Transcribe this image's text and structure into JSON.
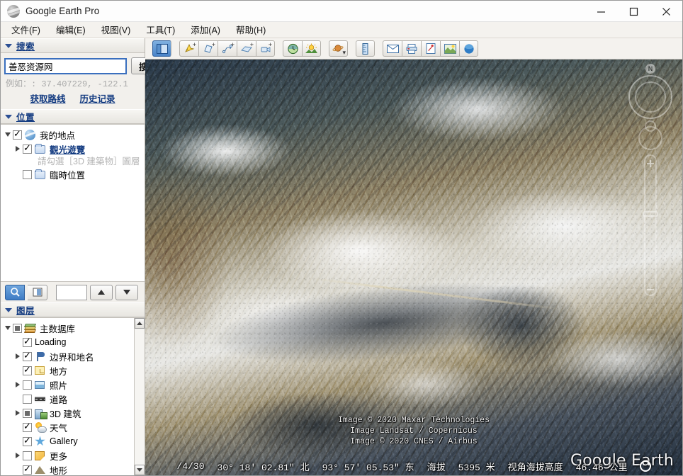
{
  "window": {
    "title": "Google Earth Pro",
    "app_icon": "globe-icon",
    "minimize": "–",
    "maximize": "□",
    "close": "✕"
  },
  "menubar": {
    "items": [
      {
        "label": "文件(F)",
        "name": "menu-file"
      },
      {
        "label": "编辑(E)",
        "name": "menu-edit"
      },
      {
        "label": "视图(V)",
        "name": "menu-view"
      },
      {
        "label": "工具(T)",
        "name": "menu-tools"
      },
      {
        "label": "添加(A)",
        "name": "menu-add"
      },
      {
        "label": "帮助(H)",
        "name": "menu-help"
      }
    ]
  },
  "toolbar": {
    "groups": [
      {
        "tools": [
          {
            "name": "toggle-sidebar-icon",
            "title": "显示/隐藏侧边栏",
            "selected": true
          }
        ]
      },
      {
        "tools": [
          {
            "name": "add-placemark-icon",
            "title": "添加地标",
            "badge": "+"
          },
          {
            "name": "add-polygon-icon",
            "title": "添加多边形",
            "badge": "+"
          },
          {
            "name": "add-path-icon",
            "title": "添加路径",
            "badge": "+"
          },
          {
            "name": "add-image-overlay-icon",
            "title": "添加图像叠加层",
            "badge": "+"
          },
          {
            "name": "record-tour-icon",
            "title": "录制游览",
            "badge": "+"
          }
        ]
      },
      {
        "tools": [
          {
            "name": "historical-imagery-icon",
            "title": "显示历史图像"
          },
          {
            "name": "sunlight-icon",
            "title": "显示横跨景观的阳光"
          }
        ]
      },
      {
        "tools": [
          {
            "name": "planet-switch-icon",
            "title": "在天空、火星和月球之间切换"
          }
        ]
      },
      {
        "tools": [
          {
            "name": "ruler-icon",
            "title": "显示标尺"
          }
        ]
      },
      {
        "tools": [
          {
            "name": "email-icon",
            "title": "通过电子邮件发送"
          },
          {
            "name": "print-icon",
            "title": "打印"
          },
          {
            "name": "view-in-maps-icon",
            "title": "在 Google 地图中查看"
          },
          {
            "name": "save-image-icon",
            "title": "保存图像"
          },
          {
            "name": "earth-icon",
            "title": "地球"
          }
        ]
      }
    ]
  },
  "sidebar": {
    "search": {
      "header": "搜索",
      "input_value": "善恶资源网",
      "input_placeholder": "",
      "button_label": "搜索",
      "hint": "例如：: 37.407229, -122.1",
      "links": [
        {
          "label": "获取路线",
          "name": "get-directions-link"
        },
        {
          "label": "历史记录",
          "name": "history-link"
        }
      ]
    },
    "places": {
      "header": "位置",
      "items": [
        {
          "label": "我的地点",
          "icon": "globe-icon",
          "checked": true,
          "twisty": "down",
          "indent": 0,
          "link": false
        },
        {
          "label": "觀光遊覽",
          "icon": "folder-icon",
          "checked": true,
          "twisty": "right",
          "indent": 1,
          "link": true
        },
        {
          "label": "臨時位置",
          "icon": "folder-icon",
          "checked": false,
          "twisty": "none",
          "indent": 1,
          "link": false
        }
      ],
      "description": "請勾選［3D 建築物］圖層",
      "tools": {
        "search_button": "magnifier-icon",
        "panel_button": "contrast-panel-icon",
        "field_value": "",
        "up_button": "arrow-up-icon",
        "down_button": "arrow-down-icon"
      }
    },
    "layers": {
      "header": "图层",
      "items": [
        {
          "label": "主数据库",
          "icon": "stack-icon",
          "state": "partial",
          "twisty": "down",
          "indent": 0
        },
        {
          "label": "Loading",
          "icon": "none",
          "state": "checked",
          "twisty": "none",
          "indent": 1
        },
        {
          "label": "边界和地名",
          "icon": "flag-icon",
          "state": "checked",
          "twisty": "right",
          "indent": 1
        },
        {
          "label": "地方",
          "icon": "place-icon",
          "state": "checked",
          "twisty": "none",
          "indent": 1
        },
        {
          "label": "照片",
          "icon": "photo-icon",
          "state": "unchecked",
          "twisty": "right",
          "indent": 1
        },
        {
          "label": "道路",
          "icon": "road-icon",
          "state": "unchecked",
          "twisty": "none",
          "indent": 1
        },
        {
          "label": "3D 建筑",
          "icon": "building-icon",
          "state": "partial",
          "twisty": "right",
          "indent": 1
        },
        {
          "label": "天气",
          "icon": "weather-icon",
          "state": "checked",
          "twisty": "none",
          "indent": 1
        },
        {
          "label": "Gallery",
          "icon": "star-icon",
          "state": "checked",
          "twisty": "none",
          "indent": 1
        },
        {
          "label": "更多",
          "icon": "more-icon",
          "state": "unchecked",
          "twisty": "right",
          "indent": 1
        },
        {
          "label": "地形",
          "icon": "terrain-icon",
          "state": "checked",
          "twisty": "none",
          "indent": 1
        }
      ]
    }
  },
  "map": {
    "attribution_line1": "Image © 2020 Maxar Technologies",
    "attribution_line2": "Image Landsat / Copernicus",
    "attribution_line3": "Image © 2020 CNES / Airbus",
    "logo": "Google Earth",
    "compass_label": "N"
  },
  "statusbar": {
    "date": "/4/30",
    "latitude": "30° 18' 02.81\" 北",
    "longitude": "93° 57' 05.53\" 东",
    "elevation_label": "海拔",
    "elevation_value": "5395 米",
    "eye_alt_label": "视角海拔高度",
    "eye_alt_value": "46.46 公里"
  },
  "colors": {
    "accent_blue": "#123a80",
    "selection_blue": "#3e7cc4",
    "panel_bg": "#f2f0ec",
    "map_dark": "#23303f"
  }
}
